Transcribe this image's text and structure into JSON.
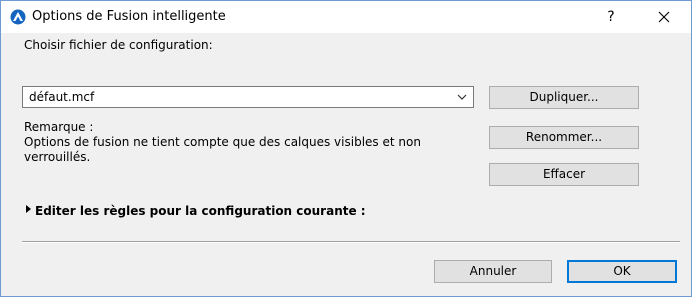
{
  "window": {
    "title": "Options de Fusion intelligente",
    "help_label": "?",
    "app_icon": "app-icon",
    "close_icon": "close-icon"
  },
  "config": {
    "label": "Choisir fichier de configuration:",
    "selected_file": "défaut.mcf"
  },
  "note": {
    "heading": "Remarque :",
    "body": "Options de fusion ne tient compte que des calques visibles et non verrouillés."
  },
  "buttons": {
    "duplicate": "Dupliquer...",
    "rename": "Renommer...",
    "delete": "Effacer",
    "cancel": "Annuler",
    "ok": "OK"
  },
  "rules_section": {
    "label": "Editer les règles pour la configuration courante :",
    "expanded": false
  },
  "colors": {
    "accent": "#0078d7",
    "window_border": "#6f9ad3",
    "dialog_bg": "#f0f0f0"
  }
}
